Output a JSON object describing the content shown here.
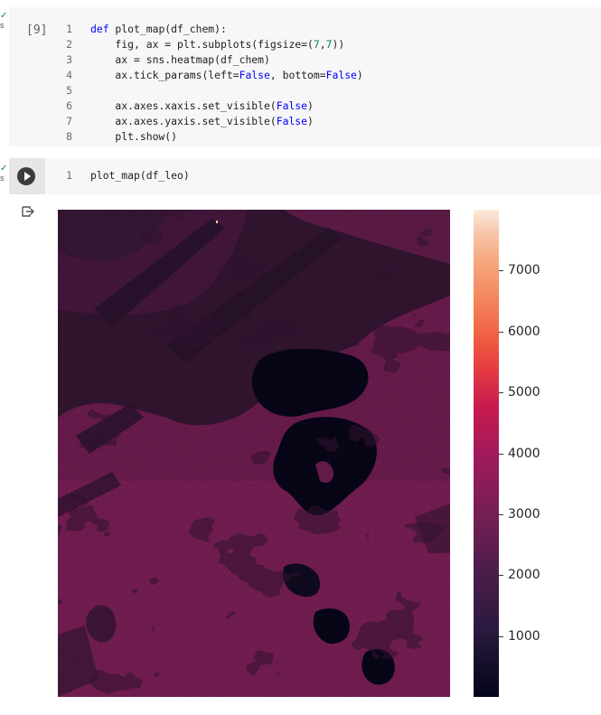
{
  "gutter": {
    "status_suffix": "s"
  },
  "cell1": {
    "execution_count": "[9]",
    "lines": [
      {
        "n": "1",
        "segments": [
          {
            "t": "def",
            "c": "kw"
          },
          {
            "t": " plot_map(df_chem):",
            "c": ""
          }
        ]
      },
      {
        "n": "2",
        "segments": [
          {
            "t": "    fig, ax = plt.subplots(figsize=(",
            "c": ""
          },
          {
            "t": "7",
            "c": "num"
          },
          {
            "t": ",",
            "c": ""
          },
          {
            "t": "7",
            "c": "num"
          },
          {
            "t": "))",
            "c": ""
          }
        ]
      },
      {
        "n": "3",
        "segments": [
          {
            "t": "    ax = sns.heatmap(df_chem)",
            "c": ""
          }
        ]
      },
      {
        "n": "4",
        "segments": [
          {
            "t": "    ax.tick_params(left=",
            "c": ""
          },
          {
            "t": "False",
            "c": "kwv"
          },
          {
            "t": ", bottom=",
            "c": ""
          },
          {
            "t": "False",
            "c": "kwv"
          },
          {
            "t": ")",
            "c": ""
          }
        ]
      },
      {
        "n": "5",
        "segments": [
          {
            "t": "",
            "c": ""
          }
        ]
      },
      {
        "n": "6",
        "segments": [
          {
            "t": "    ax.axes.xaxis.set_visible(",
            "c": ""
          },
          {
            "t": "False",
            "c": "kwv"
          },
          {
            "t": ")",
            "c": ""
          }
        ]
      },
      {
        "n": "7",
        "segments": [
          {
            "t": "    ax.axes.yaxis.set_visible(",
            "c": ""
          },
          {
            "t": "False",
            "c": "kwv"
          },
          {
            "t": ")",
            "c": ""
          }
        ]
      },
      {
        "n": "8",
        "segments": [
          {
            "t": "    plt.show()",
            "c": ""
          }
        ]
      }
    ]
  },
  "cell2": {
    "lines": [
      {
        "n": "1",
        "segments": [
          {
            "t": "plot_map(df_leo)",
            "c": ""
          }
        ]
      }
    ]
  },
  "output": {
    "colorbar": {
      "vmin": 0,
      "vmax": 8000,
      "ticks": [
        "1000",
        "2000",
        "3000",
        "4000",
        "5000",
        "6000",
        "7000"
      ],
      "colors": [
        "#03051a",
        "#4c1d4b",
        "#a11a5b",
        "#e83f3f",
        "#f6aa82",
        "#faebdd"
      ]
    }
  }
}
